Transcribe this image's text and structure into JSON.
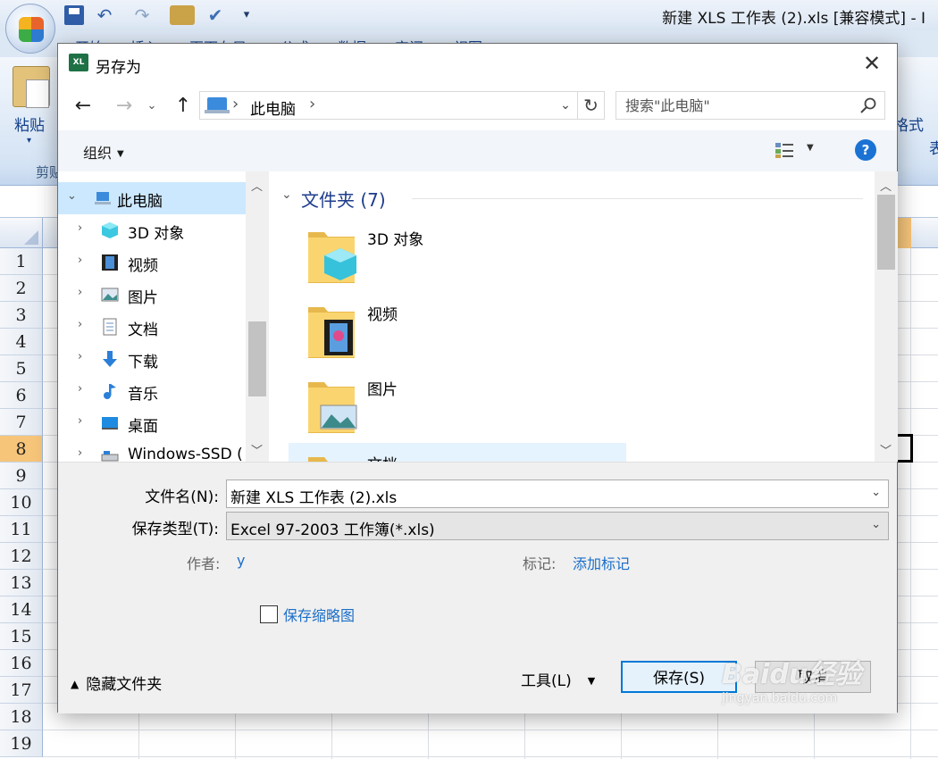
{
  "excel": {
    "window_title": "新建 XLS 工作表 (2).xls  [兼容模式] - I",
    "ribbon_tabs": [
      "开始",
      "插入",
      "页面布局",
      "公式",
      "数据",
      "审阅",
      "视图"
    ],
    "paste_label": "粘贴",
    "clipboard_group": "剪贴",
    "format_label": "格式",
    "table_label": "表",
    "row_numbers": [
      "1",
      "2",
      "3",
      "4",
      "5",
      "6",
      "7",
      "8",
      "9",
      "10",
      "11",
      "12",
      "13",
      "14",
      "15",
      "16",
      "17",
      "18",
      "19"
    ],
    "selected_row": "8"
  },
  "dialog": {
    "title": "另存为",
    "close_glyph": "✕",
    "address": {
      "location": "此电脑",
      "separator": "›"
    },
    "search_placeholder": "搜索\"此电脑\"",
    "toolbar": {
      "organize": "组织",
      "help": "?"
    },
    "nav_tree": [
      {
        "label": "此电脑",
        "icon": "computer-icon",
        "expanded": true
      },
      {
        "label": "3D 对象",
        "icon": "cube-3d-icon"
      },
      {
        "label": "视频",
        "icon": "film-icon"
      },
      {
        "label": "图片",
        "icon": "picture-icon"
      },
      {
        "label": "文档",
        "icon": "document-icon"
      },
      {
        "label": "下载",
        "icon": "download-arrow-icon"
      },
      {
        "label": "音乐",
        "icon": "music-note-icon"
      },
      {
        "label": "桌面",
        "icon": "desktop-icon"
      },
      {
        "label": "Windows-SSD (",
        "icon": "drive-icon"
      }
    ],
    "group_header": "文件夹 (7)",
    "folders": [
      {
        "name": "3D 对象",
        "icon": "folder-3d-icon"
      },
      {
        "name": "视频",
        "icon": "folder-video-icon"
      },
      {
        "name": "图片",
        "icon": "folder-pictures-icon"
      },
      {
        "name": "文档",
        "icon": "folder-documents-icon"
      }
    ],
    "form": {
      "filename_label": "文件名(N):",
      "filename_value": "新建 XLS 工作表 (2).xls",
      "filetype_label": "保存类型(T):",
      "filetype_value": "Excel 97-2003 工作簿(*.xls)",
      "author_label": "作者:",
      "author_value": "y",
      "tags_label": "标记:",
      "tags_value": "添加标记",
      "thumbnail_label": "保存缩略图"
    },
    "footer": {
      "hide_folders": "隐藏文件夹",
      "tools": "工具(L)",
      "save": "保存(S)",
      "cancel": "取消"
    }
  },
  "watermark": {
    "brand": "Baidu经验",
    "url": "jingyan.baidu.com"
  }
}
